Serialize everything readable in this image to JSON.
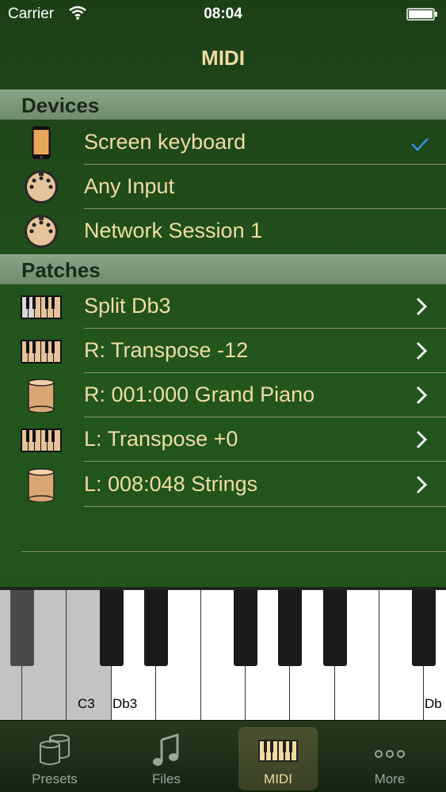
{
  "status": {
    "carrier": "Carrier",
    "time": "08:04"
  },
  "navbar": {
    "title": "MIDI"
  },
  "sections": {
    "devices": {
      "title": "Devices"
    },
    "patches": {
      "title": "Patches"
    }
  },
  "devices": [
    {
      "label": "Screen keyboard",
      "icon": "phone-icon",
      "checked": true
    },
    {
      "label": "Any Input",
      "icon": "midi-din-icon"
    },
    {
      "label": "Network Session 1",
      "icon": "midi-din-icon"
    }
  ],
  "patches": [
    {
      "label": "Split Db3",
      "icon": "keyboard-split-icon"
    },
    {
      "label": "R: Transpose -12",
      "icon": "keyboard-icon"
    },
    {
      "label": "R: 001:000 Grand Piano",
      "icon": "cylinder-icon"
    },
    {
      "label": "L: Transpose +0",
      "icon": "keyboard-icon"
    },
    {
      "label": "L: 008:048 Strings",
      "icon": "cylinder-icon"
    }
  ],
  "keyboard": {
    "label_c3": "C3",
    "label_db3": "Db3",
    "label_db_right": "Db"
  },
  "tabs": [
    {
      "label": "Presets",
      "icon": "presets-icon"
    },
    {
      "label": "Files",
      "icon": "music-note-icon"
    },
    {
      "label": "MIDI",
      "icon": "piano-keys-icon",
      "active": true
    },
    {
      "label": "More",
      "icon": "more-dots-icon"
    }
  ],
  "colors": {
    "label": "#f0dca3",
    "accent_check": "#3a8fe8"
  }
}
